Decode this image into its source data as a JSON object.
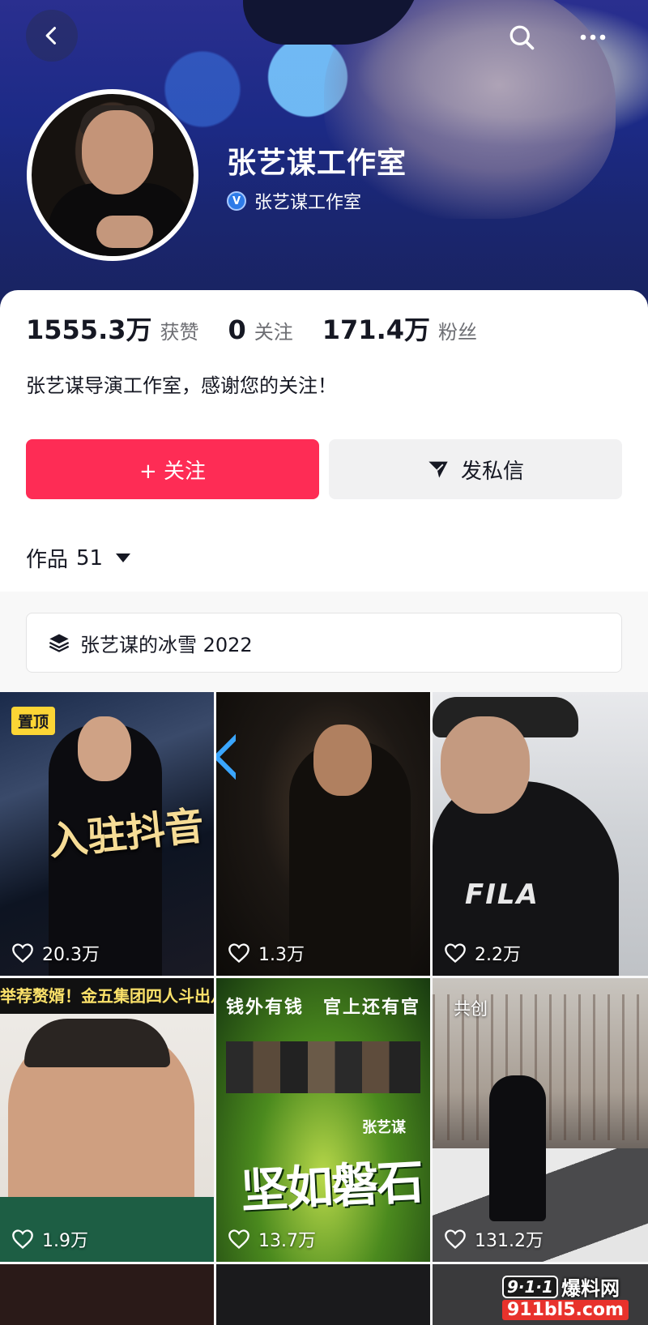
{
  "header": {
    "profile_name": "张艺谋工作室",
    "verified_label": "张艺谋工作室",
    "verified_mark": "V"
  },
  "stats": [
    {
      "value": "1555.3万",
      "label": "获赞"
    },
    {
      "value": "0",
      "label": "关注"
    },
    {
      "value": "171.4万",
      "label": "粉丝"
    }
  ],
  "bio": "张艺谋导演工作室，感谢您的关注！",
  "actions": {
    "follow_label": "+ 关注",
    "message_label": "发私信"
  },
  "works_tab": {
    "label": "作品",
    "count": "51"
  },
  "collection": {
    "label": "张艺谋的冰雪 2022"
  },
  "videos": [
    {
      "likes": "20.3万",
      "tag": "置顶",
      "overlay": "入驻抖音"
    },
    {
      "likes": "1.3万"
    },
    {
      "likes": "2.2万",
      "overlay": "FILA"
    },
    {
      "likes": "1.9万",
      "overlay": "举荐赘婿！金五集团四人斗出八百"
    },
    {
      "likes": "13.7万",
      "overlay_top": "钱外有钱　官上还有官",
      "overlay_title": "坚如磐石",
      "overlay_dir": "张艺谋"
    },
    {
      "likes": "131.2万",
      "tag": "共创"
    }
  ],
  "watermark": {
    "logo": "9·1·1",
    "text": "爆料网",
    "url": "911bl5.com"
  },
  "colors": {
    "accent": "#fe2c55",
    "pinned_tag": "#fcd535",
    "verified": "#2e7be8"
  },
  "icons": [
    "back-icon",
    "search-icon",
    "more-icon",
    "verified-icon",
    "plus-icon",
    "send-icon",
    "dropdown-icon",
    "stack-icon",
    "heart-icon"
  ]
}
